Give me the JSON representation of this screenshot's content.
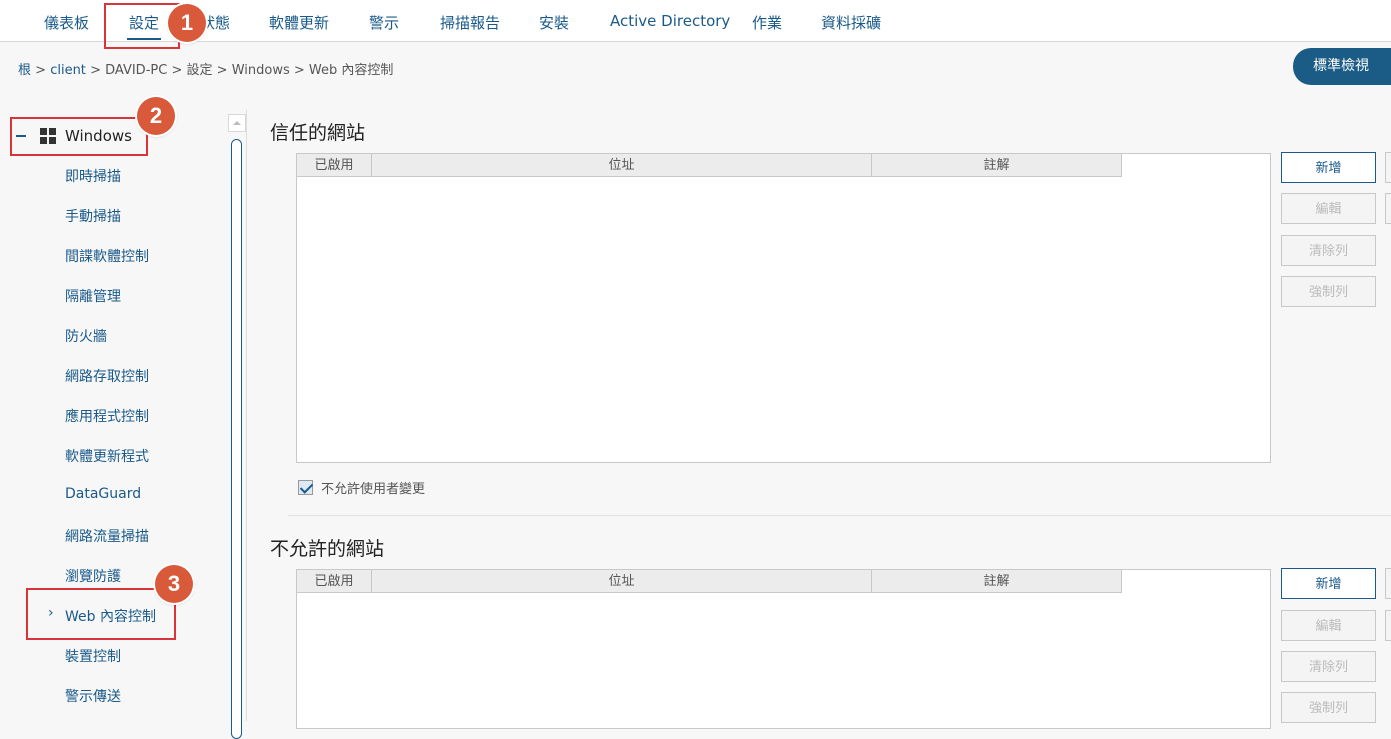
{
  "topnav": {
    "tabs": [
      {
        "label": "儀表板"
      },
      {
        "label": "設定"
      },
      {
        "label": "狀態"
      },
      {
        "label": "軟體更新"
      },
      {
        "label": "警示"
      },
      {
        "label": "掃描報告"
      },
      {
        "label": "安裝"
      },
      {
        "label": "Active Directory"
      },
      {
        "label": "作業"
      },
      {
        "label": "資料採礦"
      }
    ],
    "active_tab": "設定"
  },
  "callouts": [
    "1",
    "2",
    "3"
  ],
  "breadcrumb": {
    "items": [
      "根",
      "client",
      "DAVID-PC",
      "設定",
      "Windows",
      "Web 內容控制"
    ],
    "separator": ">"
  },
  "std_view_button": "標準檢視",
  "sidebar": {
    "root_label": "Windows",
    "items": [
      "即時掃描",
      "手動掃描",
      "間諜軟體控制",
      "隔離管理",
      "防火牆",
      "網路存取控制",
      "應用程式控制",
      "軟體更新程式",
      "DataGuard",
      "網路流量掃描",
      "瀏覽防護",
      "Web 內容控制",
      "裝置控制",
      "警示傳送"
    ],
    "selected_index": 11
  },
  "trusted": {
    "title": "信任的網站",
    "columns": [
      "已啟用",
      "位址",
      "註解"
    ],
    "buttons": {
      "add": "新增",
      "edit": "編輯",
      "clear": "清除列",
      "force": "強制列"
    },
    "disallow_label": "不允許使用者變更",
    "disallow_checked": true
  },
  "blocked": {
    "title": "不允許的網站",
    "columns": [
      "已啟用",
      "位址",
      "註解"
    ],
    "buttons": {
      "add": "新增",
      "edit": "編輯",
      "clear": "清除列",
      "force": "強制列"
    }
  },
  "colors": {
    "accent": "#1a5a8a",
    "callout": "#d95a3b",
    "highlight_box": "#d9343a",
    "primary_button": "#1b5c86"
  }
}
